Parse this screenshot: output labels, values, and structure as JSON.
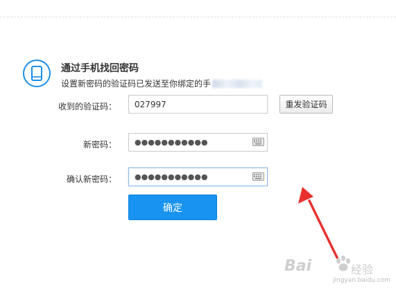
{
  "header": {
    "title": "通过手机找回密码",
    "subtitle": "设置新密码的验证码已发送至你绑定的手"
  },
  "form": {
    "code_label": "收到的验证码：",
    "code_value": "027997",
    "resend_label": "重发验证码",
    "new_password_label": "新密码：",
    "new_password_mask": "●●●●●●●●●●●",
    "confirm_password_label": "确认新密码：",
    "confirm_password_mask": "●●●●●●●●●●●",
    "submit_label": "确定"
  },
  "icons": {
    "header_icon": "phone-icon",
    "password_icon": "keyboard-icon",
    "annotation": "red-arrow"
  },
  "watermark": {
    "brand": "Bai",
    "cn": "经验",
    "url": "jingyan.baidu.com"
  },
  "colors": {
    "accent": "#1894f0",
    "arrow": "#e8312f",
    "text": "#333333"
  }
}
